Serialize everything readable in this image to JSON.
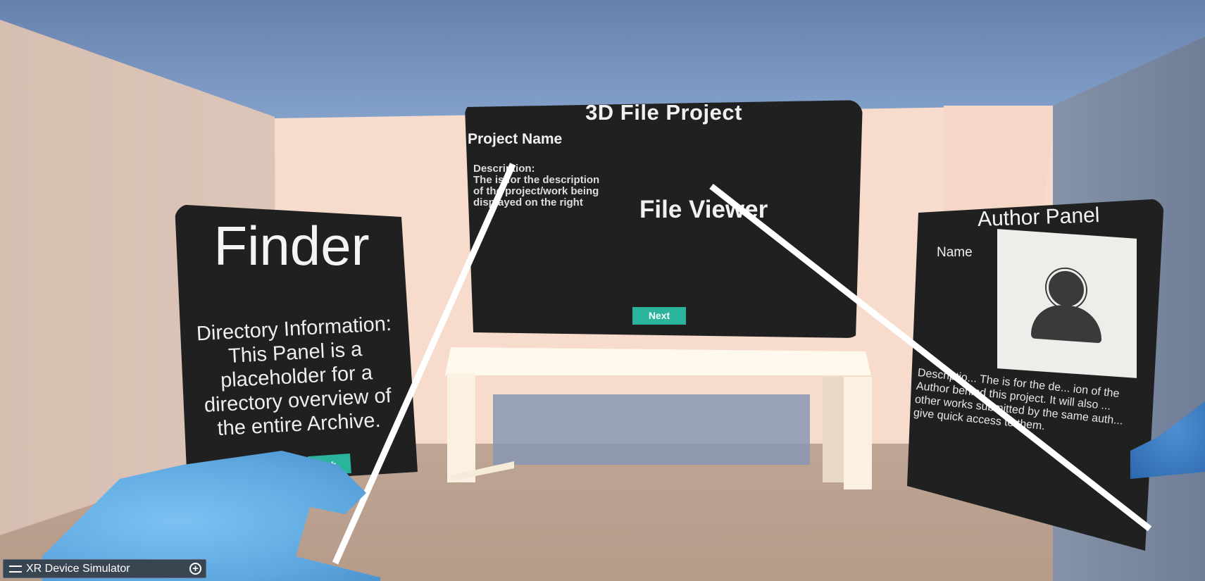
{
  "scene": {
    "center_panel": {
      "title": "3D File Project",
      "project_name": "Project Name",
      "description": "Description:\nThe is for the description of the project/work being displayed on the right",
      "viewer_label": "File Viewer",
      "next_button": "Next"
    },
    "finder_panel": {
      "title": "Finder",
      "body": "Directory Information: This Panel is a placeholder for a directory overview of the entire Archive.",
      "search_button": "rch"
    },
    "author_panel": {
      "title": "Author Panel",
      "name_label": "Name",
      "avatar_icon": "user-icon",
      "description": "Descriptio... The is for the de... ion of the Author behind this project. It will also ... other works submitted by the same auth... give quick access to them."
    }
  },
  "simulator": {
    "label": "XR Device Simulator",
    "grip_icon": "drag-handle-icon",
    "add_icon": "plus-circle-icon"
  }
}
